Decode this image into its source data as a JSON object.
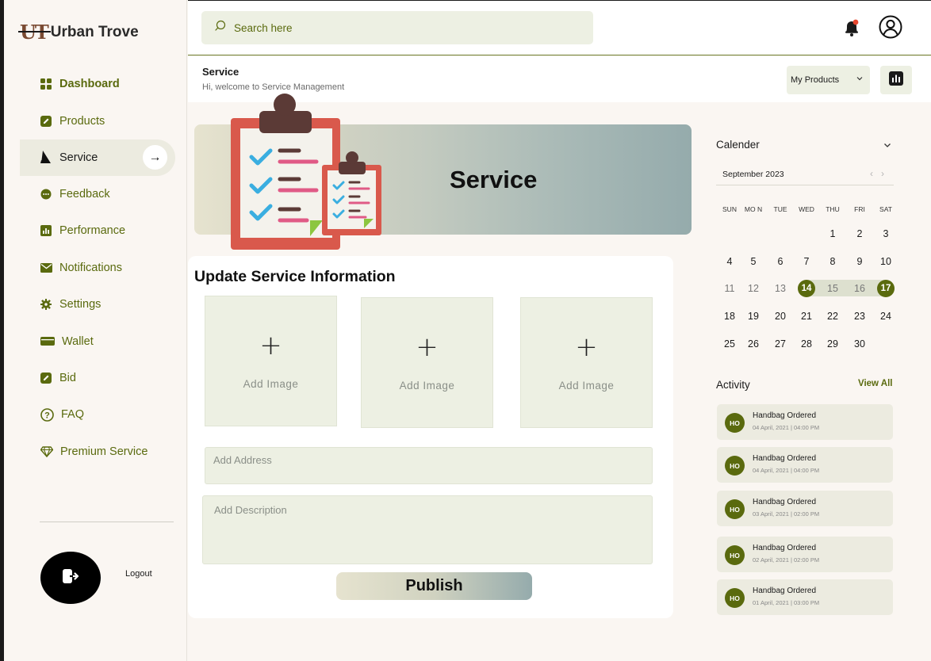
{
  "brand": {
    "mark": "UT",
    "name": "Urban Trove"
  },
  "sidebar": {
    "items": [
      {
        "label": "Dashboard",
        "icon": "dashboard-icon"
      },
      {
        "label": "Products",
        "icon": "edit-icon"
      },
      {
        "label": "Service",
        "icon": "sail-icon"
      },
      {
        "label": "Feedback",
        "icon": "chat-icon"
      },
      {
        "label": "Performance",
        "icon": "bar-chart-icon"
      },
      {
        "label": "Notifications",
        "icon": "mail-icon"
      },
      {
        "label": "Settings",
        "icon": "gear-icon"
      },
      {
        "label": "Wallet",
        "icon": "wallet-icon"
      },
      {
        "label": "Bid",
        "icon": "edit-icon"
      },
      {
        "label": "FAQ",
        "icon": "question-icon"
      },
      {
        "label": "Premium Service",
        "icon": "diamond-icon"
      }
    ],
    "active_arrow": "→",
    "logout_label": "Logout"
  },
  "search": {
    "placeholder": "Search here"
  },
  "page": {
    "title": "Service",
    "subtitle": "Hi, welcome to Service Management",
    "product_select": "My Products"
  },
  "banner": {
    "title": "Service"
  },
  "form": {
    "title": "Update Service Information",
    "image_slots": [
      {
        "plus": "+",
        "label": "Add  Image"
      },
      {
        "plus": "+",
        "label": "Add  Image"
      },
      {
        "plus": "+",
        "label": "Add  Image"
      }
    ],
    "address_placeholder": "Add Address",
    "description_placeholder": "Add  Description",
    "publish_label": "Publish"
  },
  "calendar": {
    "title": "Calender",
    "month": "September 2023",
    "prev": "‹",
    "next": "›",
    "weekdays": [
      "SUN",
      "MO N",
      "TUE",
      "WED",
      "THU",
      "FRI",
      "SAT"
    ],
    "weeks": [
      [
        "",
        "",
        "",
        "",
        "1",
        "2",
        "3"
      ],
      [
        "4",
        "5",
        "6",
        "7",
        "8",
        "9",
        "10"
      ],
      [
        "11",
        "12",
        "13",
        "14",
        "15",
        "16",
        "17"
      ],
      [
        "18",
        "19",
        "20",
        "21",
        "22",
        "23",
        "24"
      ],
      [
        "25",
        "26",
        "27",
        "28",
        "29",
        "30",
        ""
      ]
    ],
    "range_start": "14",
    "range_end": "17"
  },
  "activity": {
    "title": "Activity",
    "view_all": "View All",
    "items": [
      {
        "initials": "HO",
        "name": "Handbag Ordered",
        "date": "04 April, 2021 | 04:00 PM"
      },
      {
        "initials": "HO",
        "name": "Handbag Ordered",
        "date": "04 April, 2021 | 04:00 PM"
      },
      {
        "initials": "HO",
        "name": "Handbag Ordered",
        "date": "03 April, 2021 | 02:00 PM"
      },
      {
        "initials": "HO",
        "name": "Handbag Ordered",
        "date": "02 April, 2021 | 02:00 PM"
      },
      {
        "initials": "HO",
        "name": "Handbag Ordered",
        "date": "01 April, 2021 | 03:00 PM"
      }
    ]
  },
  "colors": {
    "accent": "#5a6a0e",
    "field_bg": "#edf0e3",
    "page_bg": "#faf6f2"
  }
}
